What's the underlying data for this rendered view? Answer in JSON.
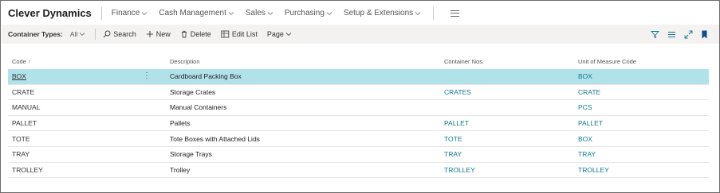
{
  "app": {
    "company": "Clever Dynamics",
    "nav": [
      {
        "label": "Finance"
      },
      {
        "label": "Cash Management"
      },
      {
        "label": "Sales"
      },
      {
        "label": "Purchasing"
      },
      {
        "label": "Setup & Extensions"
      }
    ]
  },
  "actionbar": {
    "label": "Container Types:",
    "filter_value": "All",
    "search": "Search",
    "new": "New",
    "delete": "Delete",
    "edit_list": "Edit List",
    "page": "Page"
  },
  "table": {
    "columns": [
      "Code",
      "Description",
      "Container Nos.",
      "Unit of Measure Code"
    ],
    "rows": [
      {
        "code": "BOX",
        "description": "Cardboard Packing Box",
        "container_nos": "",
        "uom": "BOX"
      },
      {
        "code": "CRATE",
        "description": "Storage Crates",
        "container_nos": "CRATES",
        "uom": "CRATE"
      },
      {
        "code": "MANUAL",
        "description": "Manual Containers",
        "container_nos": "",
        "uom": "PCS"
      },
      {
        "code": "PALLET",
        "description": "Pallets",
        "container_nos": "PALLET",
        "uom": "PALLET"
      },
      {
        "code": "TOTE",
        "description": "Tote Boxes with Attached Lids",
        "container_nos": "TOTE",
        "uom": "BOX"
      },
      {
        "code": "TRAY",
        "description": "Storage Trays",
        "container_nos": "TRAY",
        "uom": "TRAY"
      },
      {
        "code": "TROLLEY",
        "description": "Trolley",
        "container_nos": "TROLLEY",
        "uom": "TROLLEY"
      }
    ]
  },
  "colors": {
    "accent": "#0f7a8a",
    "selected_row": "#b2e2e9",
    "bookmark": "#0b4f8a"
  }
}
